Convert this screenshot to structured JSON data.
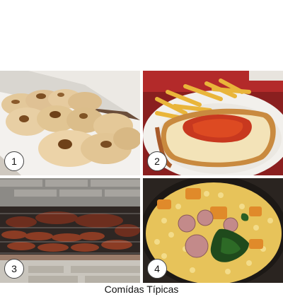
{
  "caption": "Comídas Típicas",
  "photos": [
    {
      "number": "1",
      "subject": "empanadas"
    },
    {
      "number": "2",
      "subject": "milanesa-napolitana-with-fries"
    },
    {
      "number": "3",
      "subject": "asado-grill"
    },
    {
      "number": "4",
      "subject": "locro-stew"
    }
  ]
}
